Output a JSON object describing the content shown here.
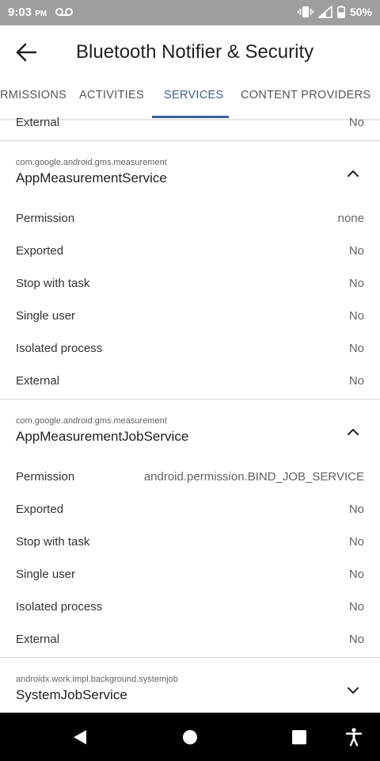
{
  "status_bar": {
    "time": "9:03",
    "ampm": "PM",
    "battery": "50%",
    "icons": [
      "voicemail-icon",
      "vibrate-icon",
      "signal-icon",
      "battery-icon"
    ]
  },
  "app_bar": {
    "title": "Bluetooth Notifier & Security",
    "back_icon": "arrow-back-icon"
  },
  "tabs": [
    {
      "label": "PERMISSIONS",
      "visible_text": "RMISSIONS",
      "active": false
    },
    {
      "label": "ACTIVITIES",
      "active": false
    },
    {
      "label": "SERVICES",
      "active": true
    },
    {
      "label": "CONTENT PROVIDERS",
      "active": false
    }
  ],
  "previous_tail": {
    "label": "External",
    "value": "No"
  },
  "services": [
    {
      "package": "com.google.android.gms.measurement",
      "name": "AppMeasurementService",
      "expanded": true,
      "properties": [
        {
          "label": "Permission",
          "value": "none"
        },
        {
          "label": "Exported",
          "value": "No"
        },
        {
          "label": "Stop with task",
          "value": "No"
        },
        {
          "label": "Single user",
          "value": "No"
        },
        {
          "label": "Isolated process",
          "value": "No"
        },
        {
          "label": "External",
          "value": "No"
        }
      ]
    },
    {
      "package": "com.google.android.gms.measurement",
      "name": "AppMeasurementJobService",
      "expanded": true,
      "properties": [
        {
          "label": "Permission",
          "value": "android.permission.BIND_JOB_SERVICE"
        },
        {
          "label": "Exported",
          "value": "No"
        },
        {
          "label": "Stop with task",
          "value": "No"
        },
        {
          "label": "Single user",
          "value": "No"
        },
        {
          "label": "Isolated process",
          "value": "No"
        },
        {
          "label": "External",
          "value": "No"
        }
      ]
    },
    {
      "package": "androidx.work.impl.background.systemjob",
      "name": "SystemJobService",
      "expanded": false,
      "properties": []
    }
  ],
  "nav_bar": {
    "buttons": [
      "back-icon",
      "home-icon",
      "recents-icon",
      "accessibility-icon"
    ]
  },
  "colors": {
    "accent": "#3f5f98",
    "status_bar": "#9e9e9e",
    "nav_bar": "#000000",
    "divider": "#d6d6d6"
  }
}
